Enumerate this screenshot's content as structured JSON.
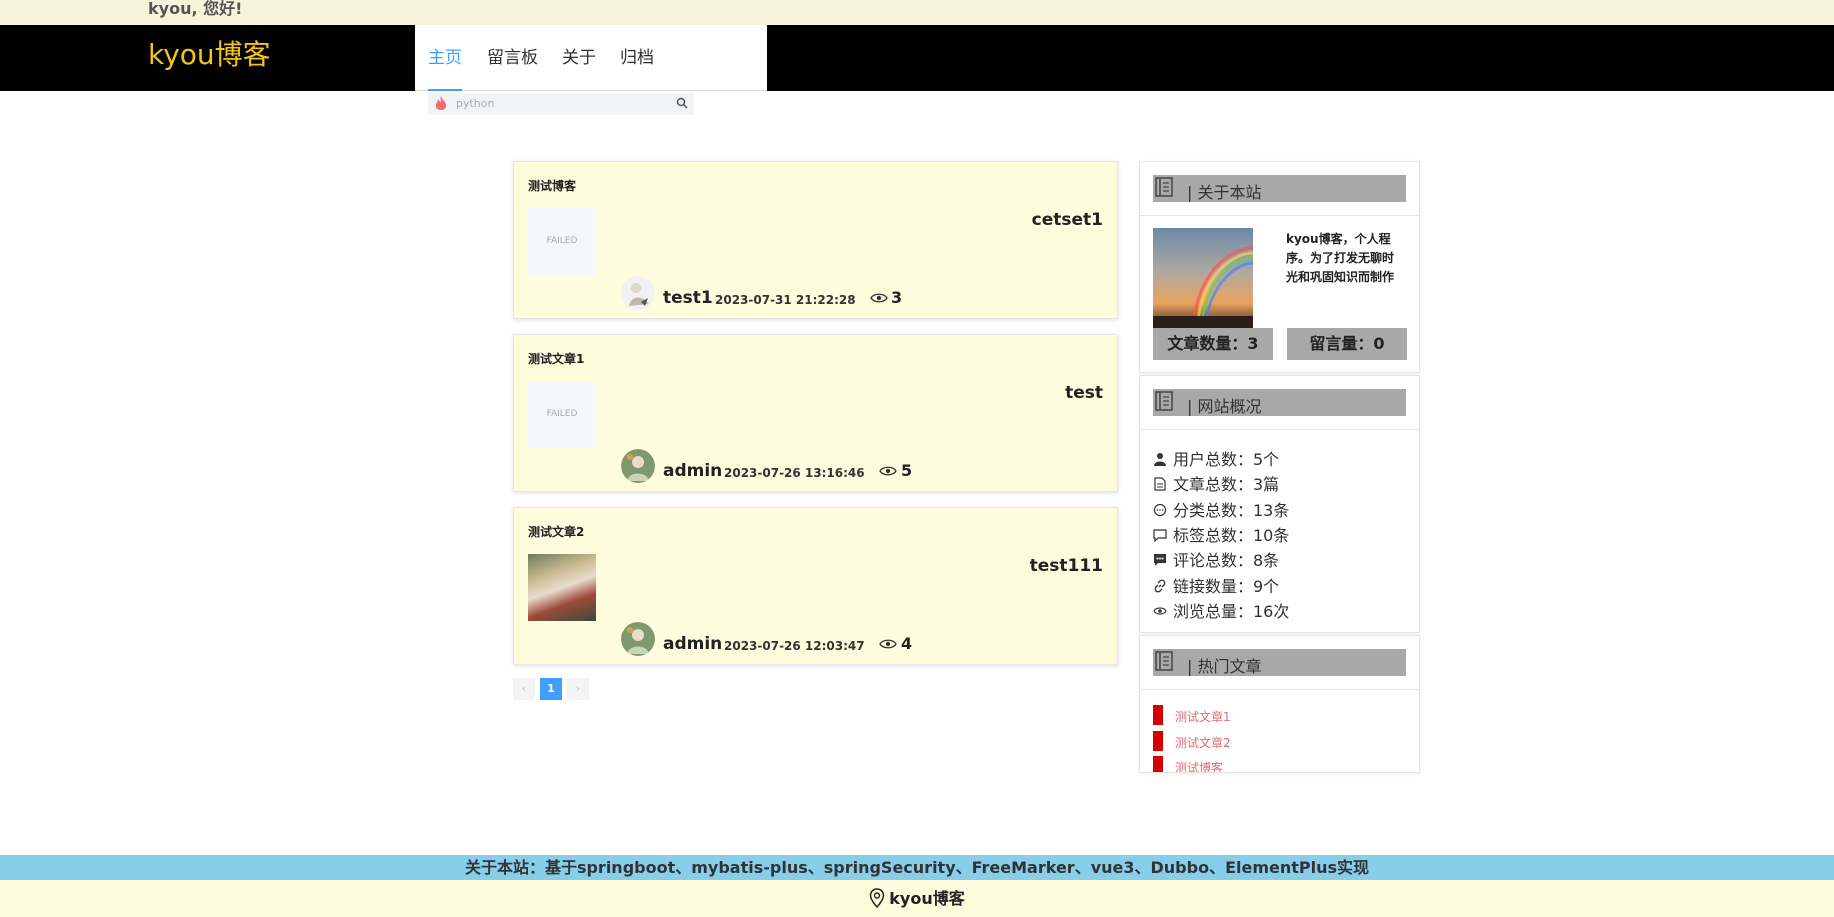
{
  "greeting": "kyou, 您好!",
  "brand": "kyou博客",
  "nav": [
    {
      "label": "主页",
      "active": true
    },
    {
      "label": "留言板",
      "active": false
    },
    {
      "label": "关于",
      "active": false
    },
    {
      "label": "归档",
      "active": false
    }
  ],
  "search": {
    "placeholder": "python",
    "icon": "fire-icon"
  },
  "articles": [
    {
      "title": "测试博客",
      "summary": "cetset1",
      "thumb": "FAILED",
      "author": "test1",
      "date": "2023-07-31 21:22:28",
      "views": "3"
    },
    {
      "title": "测试文章1",
      "summary": "test",
      "thumb": "FAILED",
      "author": "admin",
      "date": "2023-07-26 13:16:46",
      "views": "5"
    },
    {
      "title": "测试文章2",
      "summary": "test111",
      "thumb": "",
      "author": "admin",
      "date": "2023-07-26 12:03:47",
      "views": "4"
    }
  ],
  "pagination": {
    "prev": "‹",
    "current": "1",
    "next": "›"
  },
  "about": {
    "header": "| 关于本站",
    "text": "kyou博客，个人程序。为了打发无聊时光和巩固知识而制作",
    "article_count": "文章数量：3",
    "message_count": "留言量：0"
  },
  "overview": {
    "header": "| 网站概况",
    "items": [
      {
        "icon": "user-icon",
        "label": "用户总数：5个"
      },
      {
        "icon": "document-icon",
        "label": "文章总数：3篇"
      },
      {
        "icon": "chat-bubble-icon",
        "label": "分类总数：13条"
      },
      {
        "icon": "comment-icon",
        "label": "标签总数：10条"
      },
      {
        "icon": "comment-dots-icon",
        "label": "评论总数：8条"
      },
      {
        "icon": "link-icon",
        "label": "链接数量：9个"
      },
      {
        "icon": "eye-icon",
        "label": "浏览总量：16次"
      }
    ]
  },
  "hot": {
    "header": "| 热门文章",
    "items": [
      {
        "rank": "1",
        "title": "测试文章1"
      },
      {
        "rank": "2",
        "title": "测试文章2"
      },
      {
        "rank": "3",
        "title": "测试博客"
      }
    ]
  },
  "footer": {
    "about": "关于本站：基于springboot、mybatis-plus、springSecurity、FreeMarker、vue3、Dubbo、ElementPlus实现",
    "brand": "kyou博客"
  },
  "colors": {
    "brand": "#f0c419",
    "accent": "#409eff",
    "card_bg": "#fffcdd",
    "hot_rank": "#d50000",
    "footer_bar": "#87ceeb"
  }
}
